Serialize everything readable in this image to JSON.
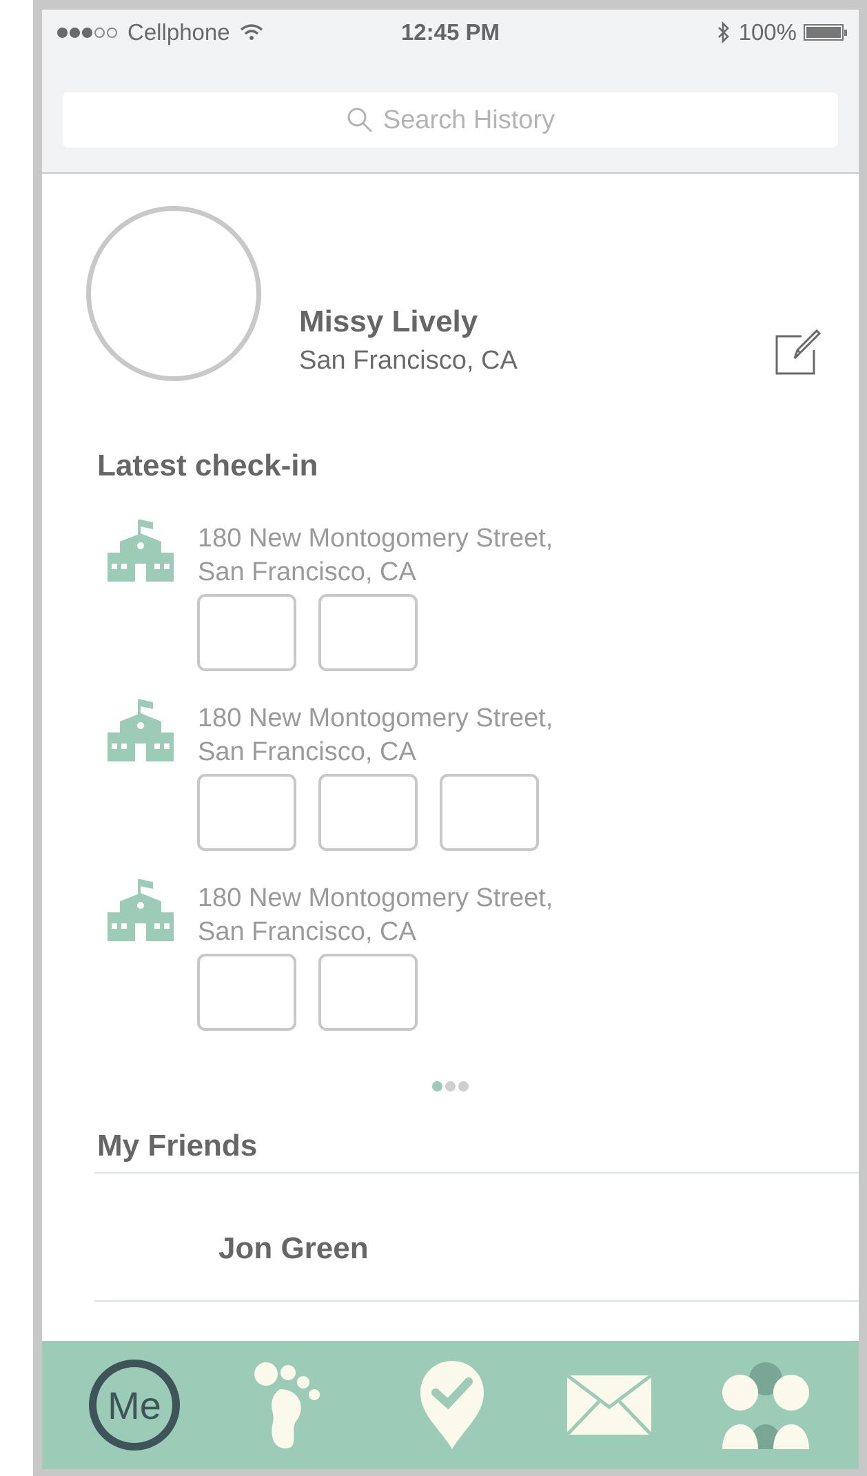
{
  "status_bar": {
    "carrier": "Cellphone",
    "time": "12:45 PM",
    "battery": "100%"
  },
  "search": {
    "placeholder": "Search History"
  },
  "profile": {
    "name": "Missy Lively",
    "location": "San Francisco, CA"
  },
  "latest_checkin": {
    "title": "Latest check-in",
    "items": [
      {
        "address_line1": "180 New Montogomery Street,",
        "address_line2": "San Francisco, CA",
        "photo_count": 2
      },
      {
        "address_line1": "180 New Montogomery Street,",
        "address_line2": "San Francisco, CA",
        "photo_count": 3
      },
      {
        "address_line1": "180 New Montogomery Street,",
        "address_line2": "San Francisco, CA",
        "photo_count": 2
      }
    ],
    "pager": {
      "pages": 3,
      "current": 1
    }
  },
  "friends": {
    "title": "My Friends",
    "items": [
      {
        "name": "Jon Green"
      }
    ]
  },
  "tabbar": {
    "me_label": "Me",
    "tabs": [
      "me-tab",
      "footprints-icon",
      "checkin-pin-icon",
      "mail-icon",
      "people-icon"
    ],
    "colors": {
      "background": "#9ccbb7",
      "active_ring": "#3e5459",
      "icon": "#fbf8ec"
    }
  },
  "colors": {
    "accent_green": "#9ccbb7",
    "building_icon": "#9ccbb7",
    "text_dark": "#666666",
    "text_light": "#9a9a9a"
  }
}
